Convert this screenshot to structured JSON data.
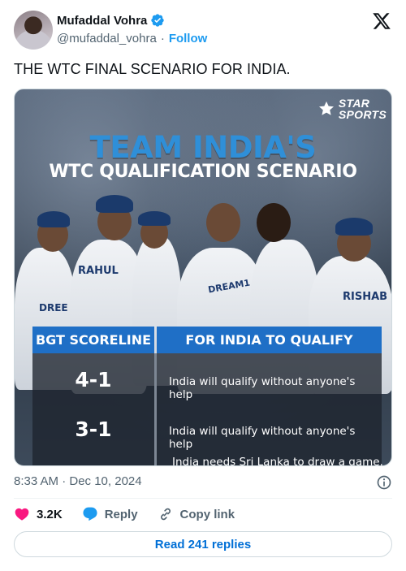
{
  "author": {
    "name": "Mufaddal Vohra",
    "handle": "@mufaddal_vohra",
    "separator": "·",
    "follow_label": "Follow"
  },
  "tweet": {
    "text": "THE WTC FINAL SCENARIO FOR INDIA."
  },
  "media": {
    "brand_line1": "STAR",
    "brand_line2": "SPORTS",
    "title_line1": "TEAM INDIA'S",
    "title_line2": "WTC QUALIFICATION SCENARIO",
    "jersey_labels": [
      "RAHUL",
      "DREE",
      "DREAM1",
      "RISHAB"
    ],
    "table": {
      "headers": [
        "BGT SCORELINE",
        "FOR INDIA TO QUALIFY"
      ],
      "rows": [
        {
          "score": "4-1",
          "text": "India will qualify without anyone's help"
        },
        {
          "score": "3-1",
          "text": "India will qualify without anyone's help"
        },
        {
          "score": "",
          "text": "India needs Sri Lanka to draw a game."
        }
      ]
    }
  },
  "meta": {
    "timestamp": "8:33 AM · Dec 10, 2024"
  },
  "actions": {
    "likes": "3.2K",
    "reply_label": "Reply",
    "copy_label": "Copy link"
  },
  "read_replies_label": "Read 241 replies",
  "colors": {
    "accent": "#1d9bf0",
    "like": "#f91880",
    "table_header": "#1f6fc6",
    "title_blue": "#2f8fd8"
  },
  "icons": [
    "verified-badge-icon",
    "x-logo-icon",
    "star-sports-logo-icon",
    "info-icon",
    "heart-icon",
    "reply-bubble-icon",
    "link-icon"
  ]
}
